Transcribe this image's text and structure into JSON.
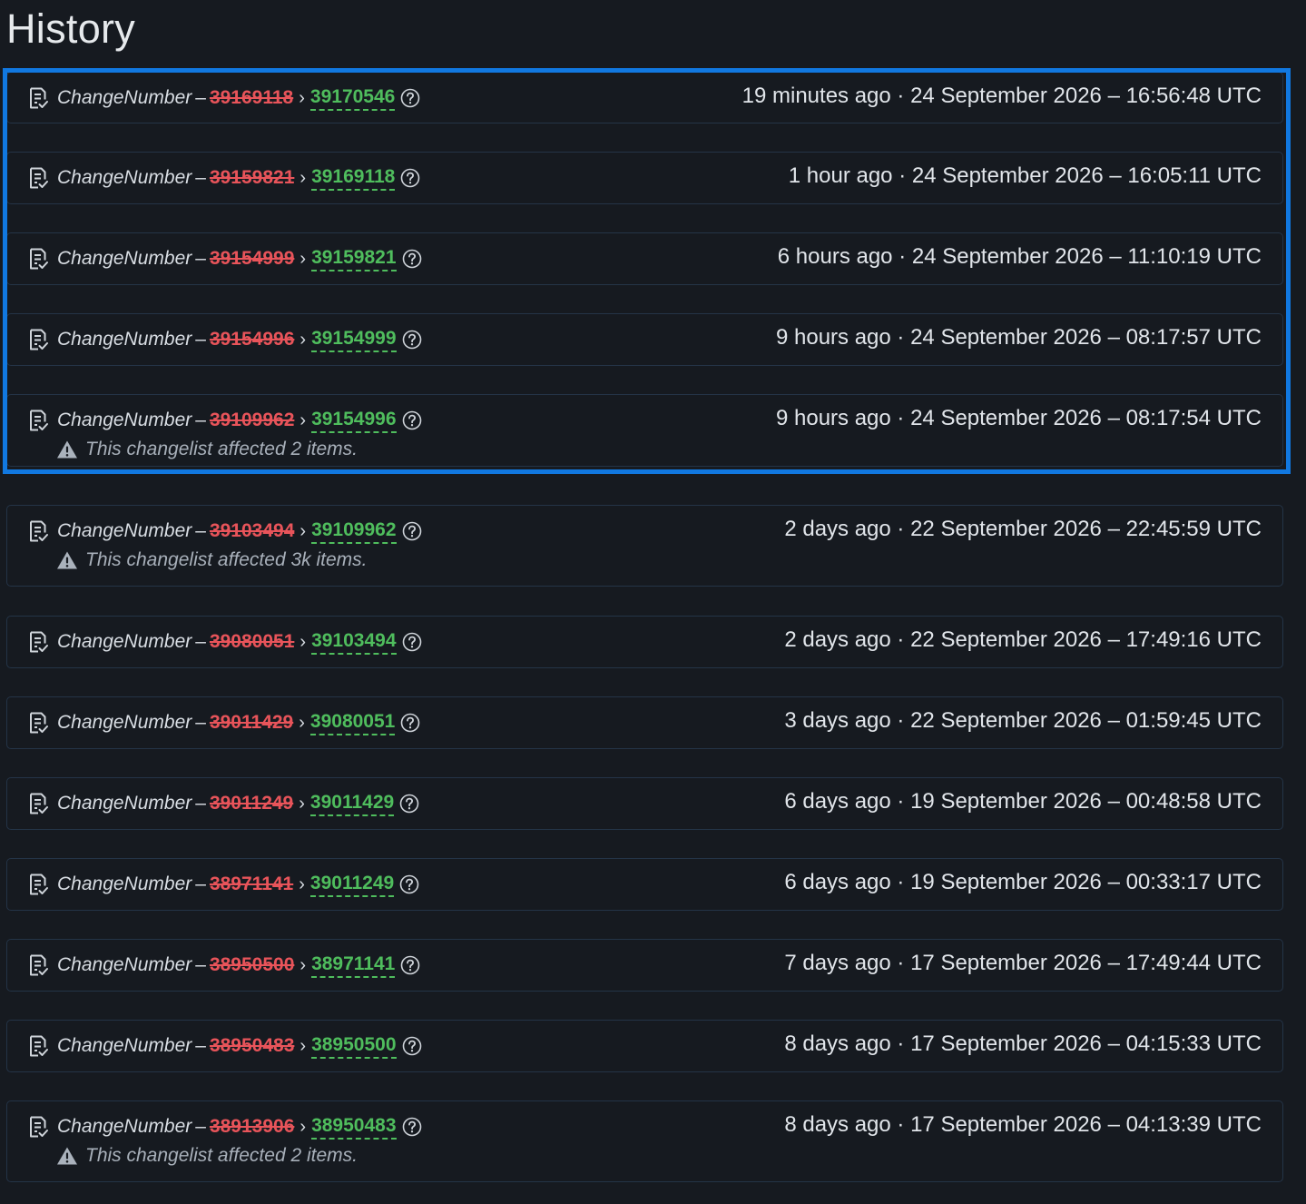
{
  "page": {
    "title": "History"
  },
  "entries": [
    {
      "label": "ChangeNumber",
      "old": "39169118",
      "new": "39170546",
      "time": "19 minutes ago · 24 September 2026 – 16:56:48 UTC",
      "note": ""
    },
    {
      "label": "ChangeNumber",
      "old": "39159821",
      "new": "39169118",
      "time": "1 hour ago · 24 September 2026 – 16:05:11 UTC",
      "note": ""
    },
    {
      "label": "ChangeNumber",
      "old": "39154999",
      "new": "39159821",
      "time": "6 hours ago · 24 September 2026 – 11:10:19 UTC",
      "note": ""
    },
    {
      "label": "ChangeNumber",
      "old": "39154996",
      "new": "39154999",
      "time": "9 hours ago · 24 September 2026 – 08:17:57 UTC",
      "note": ""
    },
    {
      "label": "ChangeNumber",
      "old": "39109962",
      "new": "39154996",
      "time": "9 hours ago · 24 September 2026 – 08:17:54 UTC",
      "note": "This changelist affected 2 items."
    },
    {
      "label": "ChangeNumber",
      "old": "39103494",
      "new": "39109962",
      "time": "2 days ago · 22 September 2026 – 22:45:59 UTC",
      "note": "This changelist affected 3k items."
    },
    {
      "label": "ChangeNumber",
      "old": "39080051",
      "new": "39103494",
      "time": "2 days ago · 22 September 2026 – 17:49:16 UTC",
      "note": ""
    },
    {
      "label": "ChangeNumber",
      "old": "39011429",
      "new": "39080051",
      "time": "3 days ago · 22 September 2026 – 01:59:45 UTC",
      "note": ""
    },
    {
      "label": "ChangeNumber",
      "old": "39011249",
      "new": "39011429",
      "time": "6 days ago · 19 September 2026 – 00:48:58 UTC",
      "note": ""
    },
    {
      "label": "ChangeNumber",
      "old": "38971141",
      "new": "39011249",
      "time": "6 days ago · 19 September 2026 – 00:33:17 UTC",
      "note": ""
    },
    {
      "label": "ChangeNumber",
      "old": "38950500",
      "new": "38971141",
      "time": "7 days ago · 17 September 2026 – 17:49:44 UTC",
      "note": ""
    },
    {
      "label": "ChangeNumber",
      "old": "38950483",
      "new": "38950500",
      "time": "8 days ago · 17 September 2026 – 04:15:33 UTC",
      "note": ""
    },
    {
      "label": "ChangeNumber",
      "old": "38913906",
      "new": "38950483",
      "time": "8 days ago · 17 September 2026 – 04:13:39 UTC",
      "note": "This changelist affected 2 items."
    }
  ],
  "colors": {
    "background": "#161a20",
    "old_value": "#e8545a",
    "new_value": "#4fbd5d",
    "selection_border": "#1178e0"
  },
  "icons": {
    "entry": "document-check-icon",
    "help": "question-circle-icon",
    "warning": "warning-triangle-icon"
  }
}
